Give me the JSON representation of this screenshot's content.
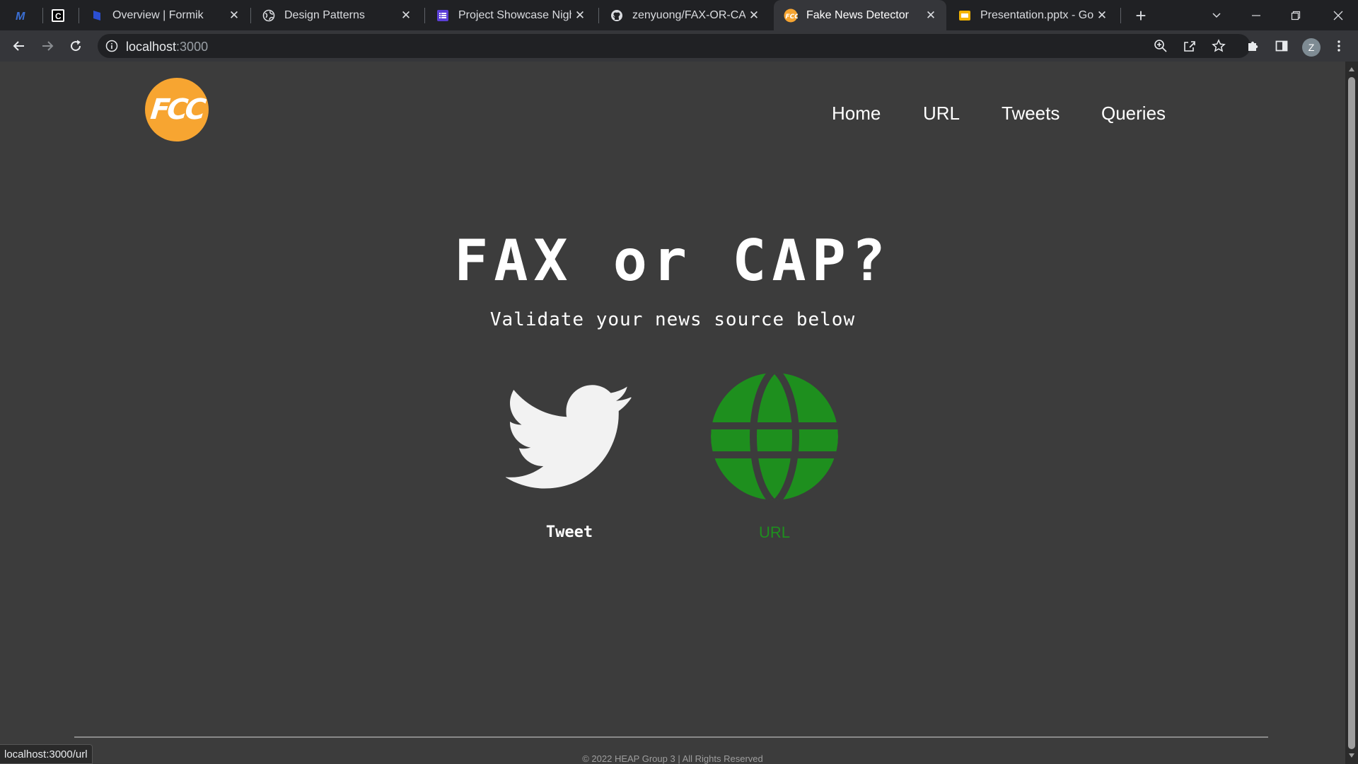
{
  "browser": {
    "tabs": [
      {
        "title": "",
        "icon": "m-logo-icon",
        "pinned": true
      },
      {
        "title": "",
        "icon": "c-logo-icon",
        "pinned": true
      },
      {
        "title": "Overview | Formik",
        "icon": "formik-icon"
      },
      {
        "title": "Design Patterns",
        "icon": "globe-icon"
      },
      {
        "title": "Project Showcase Night S",
        "icon": "list-icon"
      },
      {
        "title": "zenyuong/FAX-OR-CAP",
        "icon": "github-icon"
      },
      {
        "title": "Fake News Detector",
        "icon": "fcc-icon",
        "active": true
      },
      {
        "title": "Presentation.pptx - Goog",
        "icon": "slides-icon"
      }
    ],
    "address": {
      "host": "localhost",
      "port": ":3000"
    },
    "status_url": "localhost:3000/url",
    "profile_initial": "Z"
  },
  "page": {
    "logo_text": "FCC",
    "nav": [
      "Home",
      "URL",
      "Tweets",
      "Queries"
    ],
    "title": "FAX or CAP?",
    "subtitle": "Validate your news source below",
    "options": {
      "tweet_label": "Tweet",
      "url_label": "URL"
    },
    "footer": "© 2022 HEAP Group 3 | All Rights Reserved"
  },
  "colors": {
    "page_bg": "#3c3c3c",
    "logo_orange": "#f7a531",
    "globe_green": "#1e8f1e",
    "text_white": "#ffffff"
  }
}
